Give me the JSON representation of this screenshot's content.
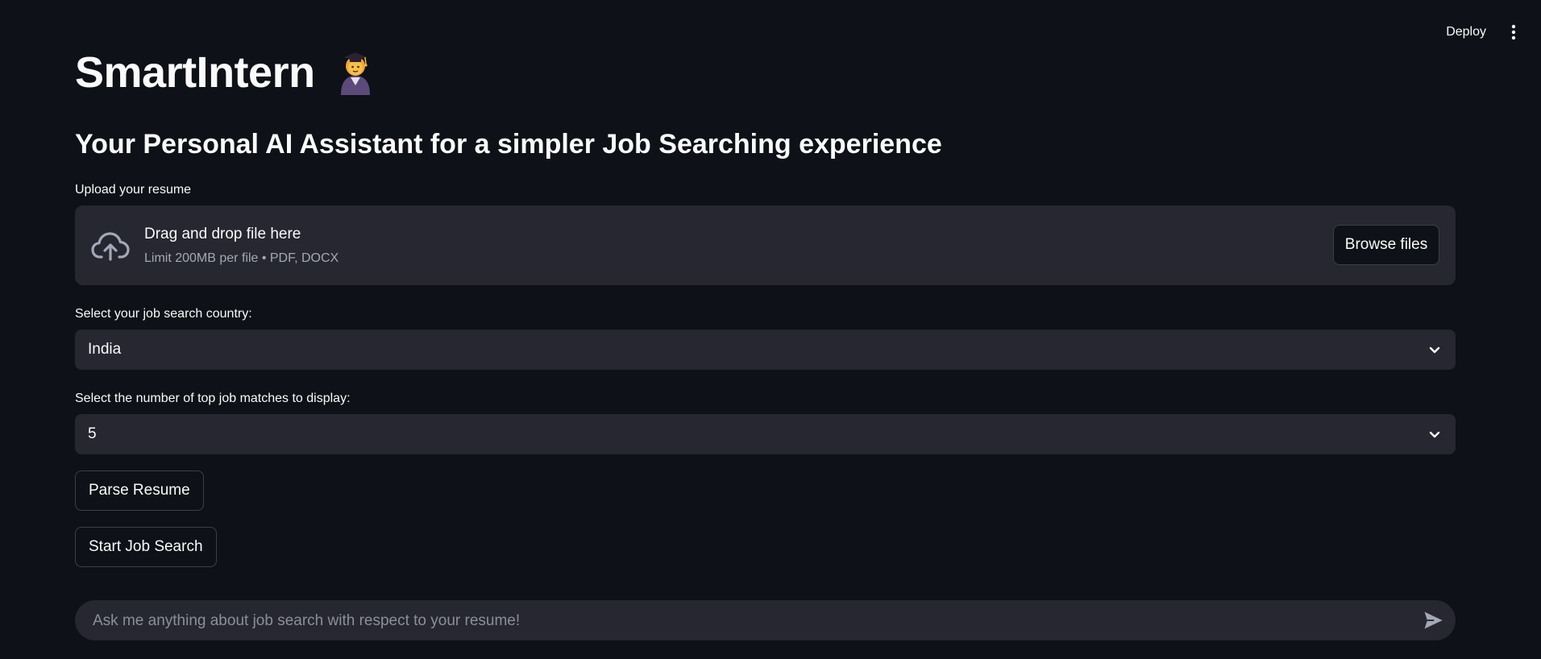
{
  "header": {
    "deploy_label": "Deploy",
    "menu_icon": "kebab-menu-icon"
  },
  "main": {
    "title": "SmartIntern",
    "title_emoji": "student-emoji",
    "subtitle": "Your Personal AI Assistant for a simpler Job Searching experience"
  },
  "uploader": {
    "label": "Upload your resume",
    "drop_text": "Drag and drop file here",
    "limit_text": "Limit 200MB per file • PDF, DOCX",
    "browse_label": "Browse files",
    "icon": "cloud-upload-icon"
  },
  "country_select": {
    "label": "Select your job search country:",
    "value": "India"
  },
  "matches_select": {
    "label": "Select the number of top job matches to display:",
    "value": "5"
  },
  "actions": {
    "parse_label": "Parse Resume",
    "search_label": "Start Job Search"
  },
  "chat": {
    "placeholder": "Ask me anything about job search with respect to your resume!",
    "send_icon": "send-icon"
  },
  "colors": {
    "background": "#0e1117",
    "surface": "#262730",
    "text": "#fafafa",
    "muted": "#a3a8b8"
  }
}
